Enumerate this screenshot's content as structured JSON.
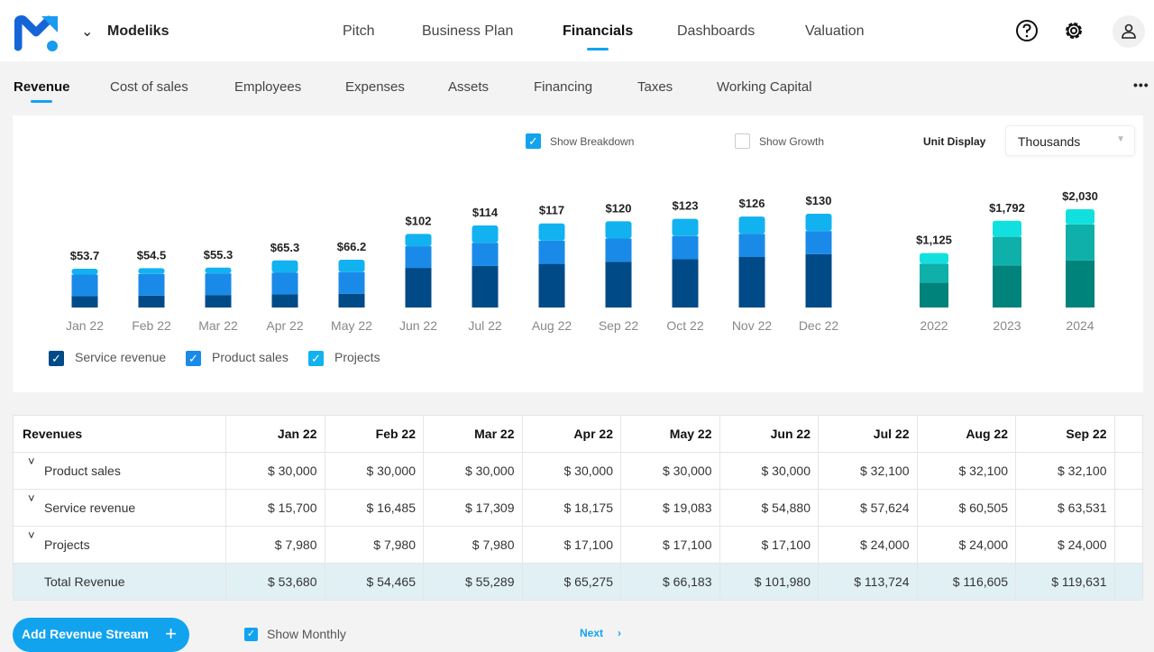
{
  "brand": {
    "name": "Modeliks"
  },
  "main_nav": [
    {
      "label": "Pitch"
    },
    {
      "label": "Business Plan"
    },
    {
      "label": "Financials",
      "active": true
    },
    {
      "label": "Dashboards"
    },
    {
      "label": "Valuation"
    }
  ],
  "sub_nav": [
    {
      "label": "Revenue",
      "active": true
    },
    {
      "label": "Cost of sales"
    },
    {
      "label": "Employees"
    },
    {
      "label": "Expenses"
    },
    {
      "label": "Assets"
    },
    {
      "label": "Financing"
    },
    {
      "label": "Taxes"
    },
    {
      "label": "Working Capital"
    }
  ],
  "options": {
    "show_breakdown": {
      "label": "Show Breakdown",
      "checked": true
    },
    "show_growth": {
      "label": "Show Growth",
      "checked": false
    },
    "unit_display_label": "Unit Display",
    "unit_display_value": "Thousands"
  },
  "colors": {
    "accent": "#12a3ef",
    "service": "#004a87",
    "product": "#1a8ae8",
    "projects": "#12b2f0",
    "year_dark": "#00837a",
    "year_mid": "#0fb0aa",
    "year_light": "#12e0de"
  },
  "chart_data": [
    {
      "type": "bar",
      "stacked": true,
      "categories": [
        "Jan 22",
        "Feb 22",
        "Mar 22",
        "Apr 22",
        "May 22",
        "Jun 22",
        "Jul 22",
        "Aug 22",
        "Sep 22",
        "Oct 22",
        "Nov 22",
        "Dec 22"
      ],
      "totals_labels": [
        "$53.7",
        "$54.5",
        "$55.3",
        "$65.3",
        "$66.2",
        "$102",
        "$114",
        "$117",
        "$120",
        "$123",
        "$126",
        "$130"
      ],
      "series": [
        {
          "name": "Service revenue",
          "values": [
            15.7,
            16.5,
            17.3,
            18.2,
            19.1,
            54.9,
            57.6,
            60.5,
            63.5,
            66.9,
            70.0,
            73.9
          ]
        },
        {
          "name": "Product sales",
          "values": [
            30,
            30,
            30,
            30,
            30,
            30,
            32.1,
            32.1,
            32.1,
            32.1,
            32.1,
            32.1
          ]
        },
        {
          "name": "Projects",
          "values": [
            8.0,
            8.0,
            8.0,
            17.1,
            17.1,
            17.1,
            24,
            24,
            24,
            24,
            24,
            24
          ]
        }
      ]
    },
    {
      "type": "bar",
      "stacked": true,
      "categories": [
        "2022",
        "2023",
        "2024"
      ],
      "totals_labels": [
        "$1,125",
        "$1,792",
        "$2,030"
      ],
      "series": [
        {
          "values": [
            515,
            870,
            970
          ]
        },
        {
          "values": [
            390,
            590,
            745
          ]
        },
        {
          "values": [
            220,
            332,
            315
          ]
        }
      ]
    }
  ],
  "legend": [
    {
      "label": "Service revenue"
    },
    {
      "label": "Product sales"
    },
    {
      "label": "Projects"
    }
  ],
  "table": {
    "header": "Revenues",
    "columns": [
      "Jan 22",
      "Feb 22",
      "Mar 22",
      "Apr 22",
      "May 22",
      "Jun 22",
      "Jul 22",
      "Aug 22",
      "Sep 22"
    ],
    "rows": [
      {
        "label": "Product sales",
        "values": [
          "$ 30,000",
          "$ 30,000",
          "$ 30,000",
          "$ 30,000",
          "$ 30,000",
          "$ 30,000",
          "$ 32,100",
          "$ 32,100",
          "$ 32,100"
        ]
      },
      {
        "label": "Service revenue",
        "values": [
          "$ 15,700",
          "$ 16,485",
          "$ 17,309",
          "$ 18,175",
          "$ 19,083",
          "$ 54,880",
          "$ 57,624",
          "$ 60,505",
          "$ 63,531"
        ]
      },
      {
        "label": "Projects",
        "values": [
          "$ 7,980",
          "$ 7,980",
          "$ 7,980",
          "$ 17,100",
          "$ 17,100",
          "$ 17,100",
          "$ 24,000",
          "$ 24,000",
          "$ 24,000"
        ]
      },
      {
        "label": "Total Revenue",
        "values": [
          "$ 53,680",
          "$ 54,465",
          "$ 55,289",
          "$ 65,275",
          "$ 66,183",
          "$ 101,980",
          "$ 113,724",
          "$ 116,605",
          "$ 119,631"
        ]
      }
    ]
  },
  "footer": {
    "add_button": "Add Revenue Stream",
    "show_monthly": "Show Monthly",
    "next": "Next"
  }
}
